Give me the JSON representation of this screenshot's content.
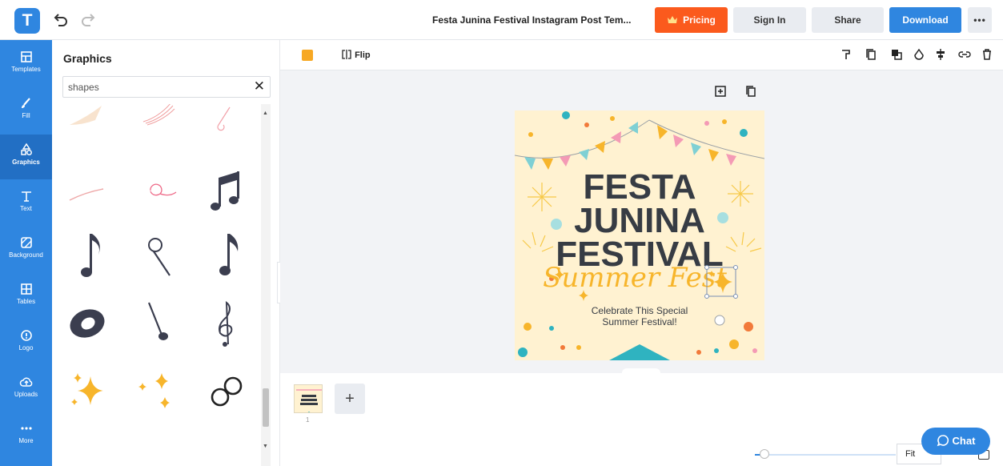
{
  "app": {
    "logo_letter": "T",
    "brand_color": "#2f86e0"
  },
  "topbar": {
    "title": "Festa Junina Festival Instagram Post Tem...",
    "pricing_label": "Pricing",
    "signin_label": "Sign In",
    "share_label": "Share",
    "download_label": "Download",
    "more_label": "•••",
    "colors": {
      "pricing": "#fb5a1d",
      "download": "#2f86e0"
    }
  },
  "rail": {
    "items": [
      {
        "label": "Templates",
        "icon": "layout-icon"
      },
      {
        "label": "Fill",
        "icon": "brush-icon"
      },
      {
        "label": "Graphics",
        "icon": "shapes-icon",
        "active": true
      },
      {
        "label": "Text",
        "icon": "text-icon"
      },
      {
        "label": "Background",
        "icon": "background-icon"
      },
      {
        "label": "Tables",
        "icon": "table-icon"
      },
      {
        "label": "Logo",
        "icon": "logo-icon"
      },
      {
        "label": "Uploads",
        "icon": "upload-cloud-icon"
      },
      {
        "label": "More",
        "icon": "more-dots-icon"
      }
    ]
  },
  "panel": {
    "title": "Graphics",
    "search_value": "shapes",
    "clear_label": "✕",
    "graphics": [
      "sweep-shape",
      "swoosh-lines",
      "scribble-line",
      "thin-curve",
      "swirl-shape",
      "beamed-notes",
      "eighth-note",
      "hollow-note",
      "eighth-note-flag",
      "whole-note",
      "quarter-note",
      "treble-clef",
      "sparkle-cluster",
      "small-sparkles",
      "linked-rings"
    ]
  },
  "toolbar": {
    "fill_color": "#f7a823",
    "flip_label": "Flip",
    "icons": [
      "format-paint-icon",
      "copy-style-icon",
      "layer-icon",
      "opacity-icon",
      "align-icon",
      "link-icon",
      "delete-icon"
    ]
  },
  "canvas": {
    "post": {
      "headline": [
        "FESTA",
        "JUNINA",
        "FESTIVAL"
      ],
      "script": "Summer Fest",
      "tagline": [
        "Celebrate This Special",
        "Summer Festival!"
      ],
      "bg_color": "#fff2d1",
      "headline_color": "#373c44",
      "accent_color": "#f7b52b"
    }
  },
  "pages": {
    "page_number": "1",
    "add_label": "+"
  },
  "zoom": {
    "fit_label": "Fit",
    "level": 0.07
  },
  "chat": {
    "label": "Chat"
  }
}
